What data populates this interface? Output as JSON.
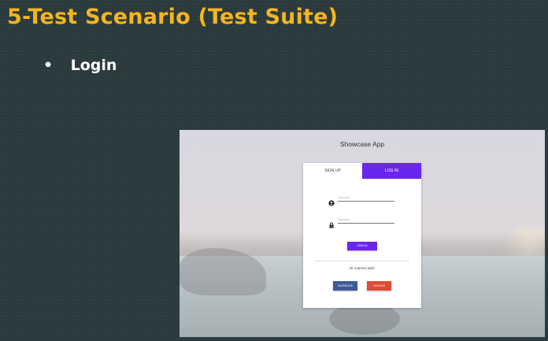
{
  "slide": {
    "title": "5-Test Scenario (Test Suite)",
    "bullet_symbol": "•",
    "bullet_text": "Login"
  },
  "app": {
    "title": "Showcase App",
    "tabs": [
      {
        "label": "SIGN UP",
        "active": false
      },
      {
        "label": "LOG IN",
        "active": true
      }
    ],
    "username_placeholder": "Username",
    "password_placeholder": "Password",
    "signin_label": "SIGN IN",
    "connect_text": "Or connect with:",
    "facebook_label": "FACEBOOK",
    "google_label": "GOOGLE"
  },
  "icons": {
    "username": "user-icon",
    "password": "lock-icon"
  },
  "colors": {
    "title": "#f5b51d",
    "accent": "#6a26ee",
    "facebook": "#3b5998",
    "google": "#dd4b39"
  }
}
